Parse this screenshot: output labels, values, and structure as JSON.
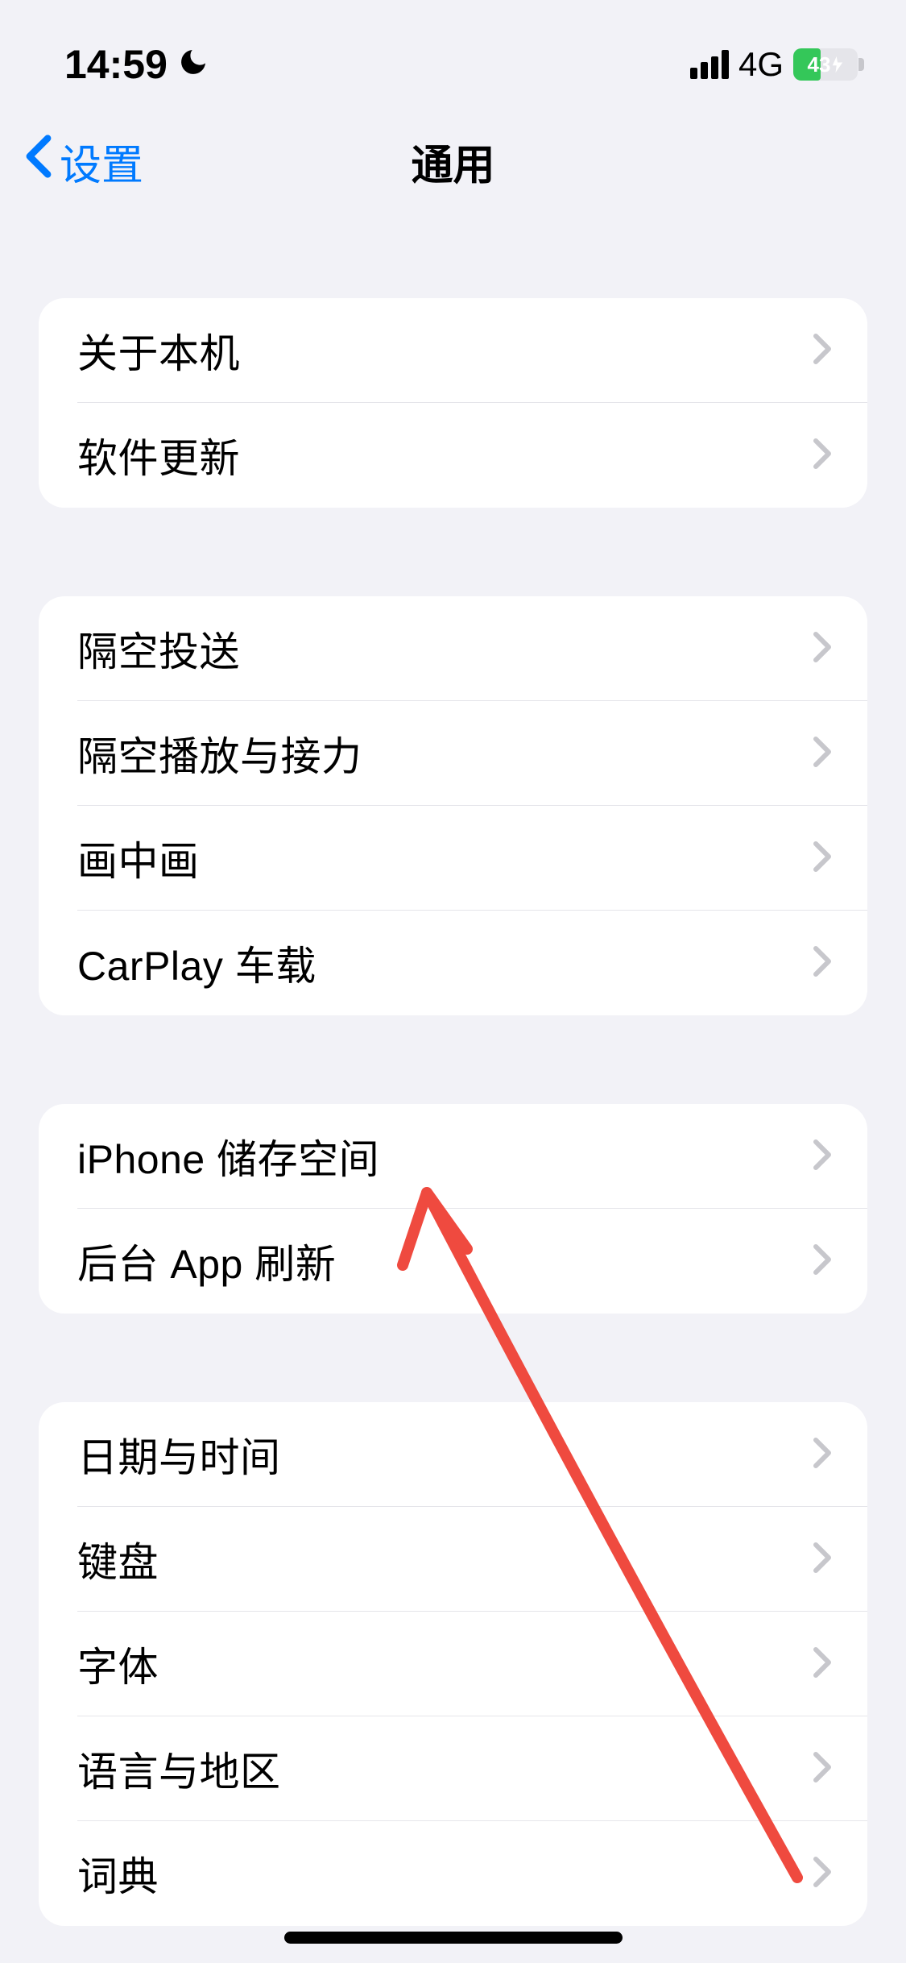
{
  "status": {
    "time": "14:59",
    "focus_icon": "moon",
    "network": "4G",
    "battery_percent": "43"
  },
  "nav": {
    "back_label": "设置",
    "title": "通用"
  },
  "groups": {
    "g1": {
      "about": "关于本机",
      "software_update": "软件更新"
    },
    "g2": {
      "airdrop": "隔空投送",
      "airplay_handoff": "隔空播放与接力",
      "pip": "画中画",
      "carplay": "CarPlay 车载"
    },
    "g3": {
      "storage": "iPhone 储存空间",
      "background_refresh": "后台 App 刷新"
    },
    "g4": {
      "date_time": "日期与时间",
      "keyboard": "键盘",
      "fonts": "字体",
      "language_region": "语言与地区",
      "dictionary": "词典"
    }
  }
}
